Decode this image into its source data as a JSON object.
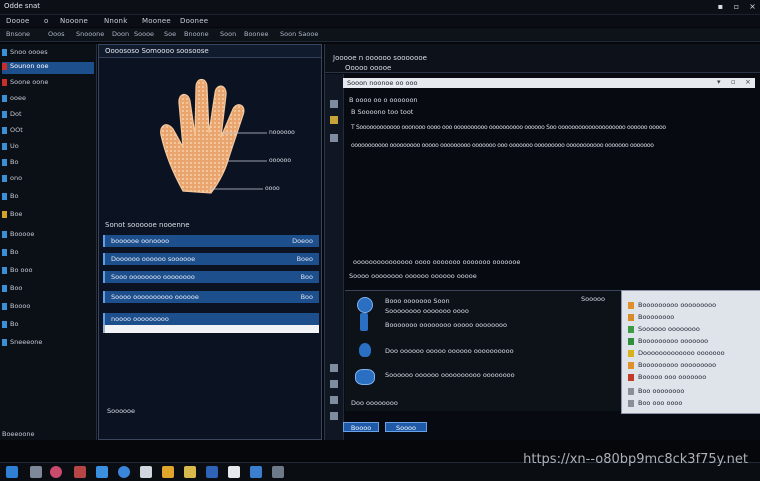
{
  "window": {
    "title": "Odde snat"
  },
  "menubar": {
    "items": [
      "Doooe",
      "o",
      "Nooone",
      "Nnonk",
      "Moonee",
      "Doonee"
    ]
  },
  "toolbar": {
    "items": [
      "Bnsone",
      "Ooos",
      "Snooone",
      "Doon",
      "Soooe",
      "Soe",
      "Bnoone",
      "Soon",
      "Boonee",
      "Soon Saooe"
    ]
  },
  "sidebar": {
    "items": [
      "Snoo oooes",
      "Sounon ooe",
      "Soone oone",
      "ooee",
      "Dot",
      "OOt",
      "Uo",
      "Bo",
      "ono",
      "Bo",
      "Boe",
      "Booooe",
      "Bo",
      "Bo ooo",
      "Boo",
      "Boooo",
      "Bo",
      "Sneeeone"
    ],
    "footer": "Boeeoone"
  },
  "center": {
    "title": "Oooososo Somoooo soosoose",
    "callouts": [
      "noooooo",
      "oooooo",
      "oooo"
    ],
    "section_label": "Sonot soooooe nooenne",
    "rows": [
      {
        "label": "boooooe oonoooo",
        "value": "Doeoo"
      },
      {
        "label": "Doooooo oooooo soooooe",
        "value": "Boeo"
      },
      {
        "label": "Sooo oooooooo oooooooo",
        "value": "Boo"
      },
      {
        "label": "Soooo oooooooooo oooooe",
        "value": "Boo"
      },
      {
        "label": "noooo ooooooooo",
        "value": ""
      }
    ],
    "footer": "Soooooe"
  },
  "right": {
    "head_line1": "Jooooe n oooooo sooooooe",
    "head_line2": "Ooooo ooooe",
    "toolbar_text": "Sooon noonoe oo ooo",
    "text_lines": [
      "B oooo oo o oooooon",
      "B  Soooono  too  toot",
      "T  Soooooooooooo ooonooo oooo ooo oooooooooo oooooooooo  oooooo Soo oooooooooooooooooooo oooooo ooooo",
      "ooooooooooo ooooooooo ooooo ooooooooo ooooooo ooo ooooooo ooooooooo ooooooooooo ooooooo ooooooo"
    ],
    "mid_line1": "ooooooooooooooo oooo ooooooo ooooooo ooooooe",
    "mid_line2": "Soooo oooooooo oooooo oooooo ooooe"
  },
  "lower": {
    "header_text": "Booo ooooooo Soon",
    "header_sub": "Soooooooo ooooooo oooo",
    "header_right": "Sooooo",
    "line2": "Booooooo oooooooo ooooo oooooooo",
    "line3": "Doo  oooooo ooooo oooooo oooooooooo",
    "line4": "Soooooo oooooo oooooooooo oooooooo",
    "footer": "Doo oooooooo",
    "btn1": "Boooo",
    "btn2": "Soooo"
  },
  "dialog": {
    "rows": [
      {
        "text": "Booooooooo ooooooooo",
        "color": "#e0902a"
      },
      {
        "text": "Boooooooo",
        "color": "#d98a28"
      },
      {
        "text": "Soooooo oooooooo",
        "color": "#3d9a45"
      },
      {
        "text": "Booooooooo ooooooo",
        "color": "#2f8f3d"
      },
      {
        "text": "Dooooooooooooo ooooooo",
        "color": "#d7b21c"
      },
      {
        "text": "Booooooooo ooooooooo",
        "color": "#e0902a"
      },
      {
        "text": "Booooo ooo ooooooo",
        "color": "#c23a2a"
      },
      {
        "text": "Boo oooooooo",
        "color": "#8a8f98"
      },
      {
        "text": "Boo ooo oooo",
        "color": "#8a8f98"
      }
    ]
  },
  "watermark": "https://xn--o80bp9mc8ck3f75y.net",
  "colors": {
    "accent": "#1e4f8d",
    "panel": "#0b1322",
    "skin": "#e9a06c"
  }
}
